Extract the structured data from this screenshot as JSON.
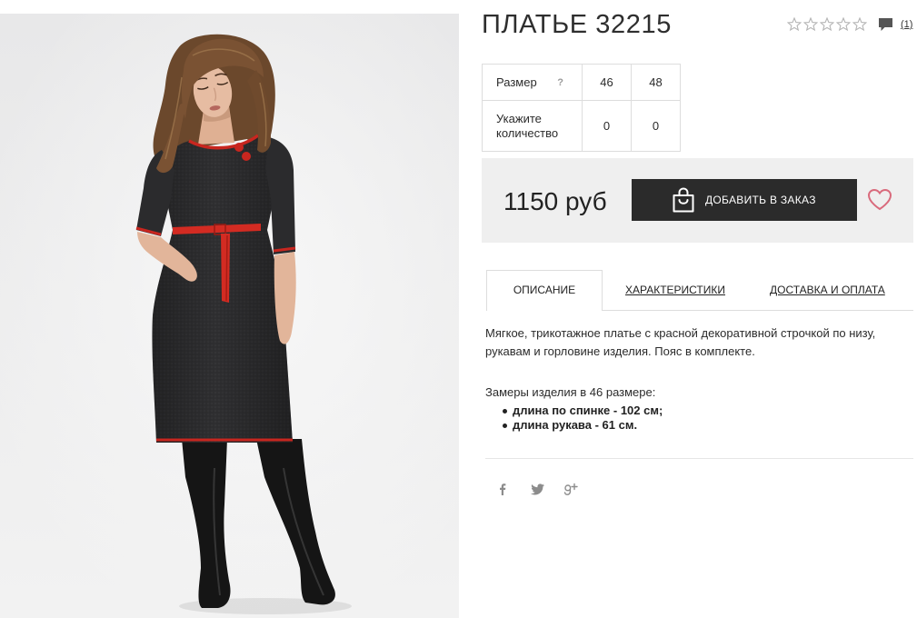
{
  "page": {
    "product_title": "ПЛАТЬЕ 32215"
  },
  "rating": {
    "stars_filled": 0,
    "stars_total": 5,
    "reviews_count": "(1)"
  },
  "size_table": {
    "size_label": "Размер",
    "help": "?",
    "quantity_label": "Укажите количество",
    "sizes": [
      "46",
      "48"
    ],
    "quantities": [
      "0",
      "0"
    ]
  },
  "purchase": {
    "price": "1150 руб",
    "add_to_order": "ДОБАВИТЬ В ЗАКАЗ"
  },
  "tabs": [
    {
      "label": "ОПИСАНИЕ",
      "active": true
    },
    {
      "label": "ХАРАКТЕРИСТИКИ",
      "active": false
    },
    {
      "label": "ДОСТАВКА И ОПЛАТА",
      "active": false
    }
  ],
  "description": {
    "text": "Мягкое, трикотажное платье с красной декоративной строчкой по низу, рукавам и горловине изделия. Пояс в комплекте.",
    "measurements_title": "Замеры изделия в 46 размере:",
    "measurements": [
      "длина по спинке - 102 см;",
      "длина рукава - 61 см."
    ]
  },
  "icons": {
    "rating": "star-icon",
    "reviews": "comment-icon",
    "add_to_order": "shopping-bag-icon",
    "wishlist": "heart-icon",
    "size_help": "question-icon",
    "share": [
      "facebook-icon",
      "twitter-icon",
      "google-plus-icon"
    ]
  },
  "colors": {
    "text": "#333333",
    "border": "#dddddd",
    "price_box_bg": "#efefef",
    "button_bg": "#2b2b2b",
    "button_text": "#ffffff",
    "heart": "#d96a7c",
    "star": "#b5b5b5",
    "social_icon": "#8c8c8c",
    "comment_icon": "#555555"
  }
}
